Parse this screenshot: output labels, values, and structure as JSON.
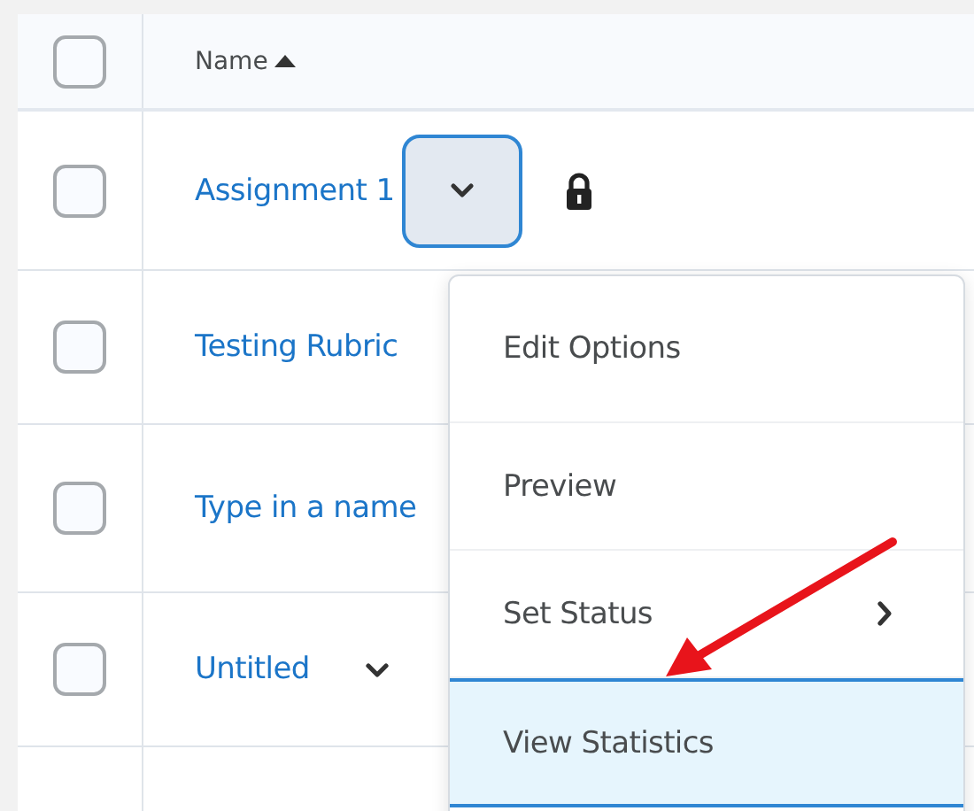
{
  "table": {
    "header": {
      "checked": false,
      "label": "Name",
      "ascending": true
    },
    "rows": [
      {
        "checked": false,
        "name": "Assignment 1",
        "menu_button": {
          "open": true
        },
        "locked": true
      },
      {
        "checked": false,
        "name": "Testing Rubric",
        "locked": false
      },
      {
        "checked": false,
        "name": "Type in a name",
        "locked": false
      },
      {
        "checked": false,
        "name": "Untitled",
        "menu_button": {
          "open": false
        },
        "locked": false
      }
    ]
  },
  "menu": {
    "items": [
      {
        "label": "Edit Options",
        "selected": false,
        "submenu": false
      },
      {
        "label": "Preview",
        "selected": false,
        "submenu": false
      },
      {
        "label": "Set Status",
        "selected": false,
        "submenu": true
      },
      {
        "label": "View Statistics",
        "selected": true,
        "submenu": false
      }
    ]
  }
}
